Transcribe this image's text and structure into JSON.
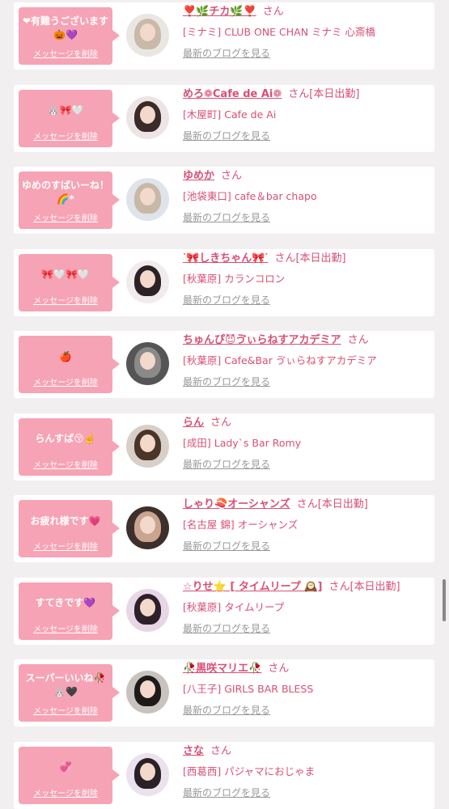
{
  "delete_label": "メッセージを削除",
  "blog_label": "最新のブログを見る",
  "suffix": "さん",
  "accent_color": "#d94f74",
  "bubble_color": "#f6a3b5",
  "cards": [
    {
      "message": "❤有難うございます🎃💜",
      "name": "❣️🌿チカ🌿❣️",
      "status": "",
      "shop": "[ミナミ] CLUB ONE CHAN ミナミ 心斎橋",
      "avatar_bg": "#eae6e3",
      "avatar_hair": "#c9b9a8"
    },
    {
      "message": "🐰🎀🤍",
      "name": "めろ❁Cafe de Ai❁",
      "status": "[本日出勤]",
      "shop": "[木屋町] Cafe de Ai",
      "avatar_bg": "#ede4e6",
      "avatar_hair": "#3a2a28"
    },
    {
      "message": "ゆめのすばいーね！🌈*",
      "name": "ゆめか",
      "status": "",
      "shop": "[池袋東口] cafe＆bar chapo",
      "avatar_bg": "#dfe3ea",
      "avatar_hair": "#c8b8a6"
    },
    {
      "message": "🎀🤍🎀🤍",
      "name": "ᐝ🎀しきちゃん🎀ᐝ",
      "status": "[本日出勤]",
      "shop": "[秋葉原] カランコロン",
      "avatar_bg": "#f1ebee",
      "avatar_hair": "#2b2226"
    },
    {
      "message": "🍎",
      "name": "ちゅんぴ😈ゔぃらねすアカデミア",
      "status": "",
      "shop": "[秋葉原] Cafe&Bar ゔぃらねすアカデミア",
      "avatar_bg": "#555555",
      "avatar_hair": "#8a8a8a"
    },
    {
      "message": "らんすば😚☝️",
      "name": "らん",
      "status": "",
      "shop": "[成田] Lady`s Bar Romy",
      "avatar_bg": "#d8cfc8",
      "avatar_hair": "#4a3528"
    },
    {
      "message": "お疲れ様です💗",
      "name": "しゃり🍣オーシャンズ",
      "status": "[本日出勤]",
      "shop": "[名古屋 錦] オーシャンズ",
      "avatar_bg": "#3d302c",
      "avatar_hair": "#c9a48f"
    },
    {
      "message": "すてきです💜",
      "name": "☆りせ⭐ [ タイムリープ 🕰️]",
      "status": "[本日出勤]",
      "shop": "[秋葉原] タイムリープ",
      "avatar_bg": "#e8d6e7",
      "avatar_hair": "#2d2028"
    },
    {
      "message": "スーパーいいね🥀🐰🖤",
      "name": "🥀黒咲マリエ🥀",
      "status": "",
      "shop": "[八王子] GIRLS BAR BLESS",
      "avatar_bg": "#c9c3c0",
      "avatar_hair": "#1f1a1a"
    },
    {
      "message": "💞",
      "name": "さな",
      "status": "",
      "shop": "[西葛西] パジャマにおじゃま",
      "avatar_bg": "#ece2ee",
      "avatar_hair": "#2a2126"
    }
  ]
}
